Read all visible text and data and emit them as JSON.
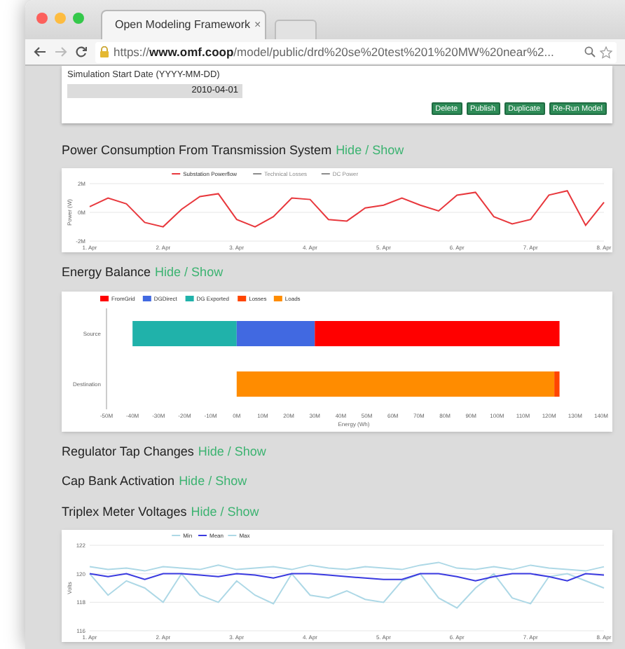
{
  "tab": {
    "title": "Open Modeling Framework",
    "close": "×"
  },
  "url": "https://**www.omf.coop**/model/public/drd%20se%20test%201%20MW%20near%2...",
  "form": {
    "label": "Simulation Start Date (YYYY-MM-DD)",
    "value": "2010-04-01",
    "buttons": [
      "Delete",
      "Publish",
      "Duplicate",
      "Re-Run Model"
    ]
  },
  "sections": [
    {
      "title": "Power Consumption From Transmission System",
      "toggle": "Hide / Show",
      "chart_data": {
        "type": "line",
        "ylabel": "Power (W)",
        "legend": true,
        "categories": [
          "1. Apr",
          null,
          null,
          null,
          "2. Apr",
          null,
          null,
          null,
          "3. Apr",
          null,
          null,
          null,
          "4. Apr",
          null,
          null,
          null,
          "5. Apr",
          null,
          null,
          null,
          "6. Apr",
          null,
          null,
          null,
          "7. Apr",
          null,
          null,
          null,
          "8. Apr"
        ],
        "ylim": [
          -2,
          2
        ],
        "yticks": [
          {
            "value": -2,
            "label": "-2M"
          },
          {
            "value": 0,
            "label": "0M"
          },
          {
            "value": 2,
            "label": "2M"
          }
        ],
        "series": [
          {
            "name": "Substation Powerflow",
            "color": "#e8383d",
            "values": [
              0.4,
              1.0,
              0.6,
              -0.7,
              -1.0,
              0.2,
              1.1,
              1.3,
              -0.5,
              -1.0,
              -0.3,
              1.0,
              0.9,
              -0.5,
              -0.6,
              0.3,
              0.5,
              1.0,
              0.5,
              0.1,
              1.2,
              1.4,
              -0.3,
              -0.8,
              -0.5,
              1.2,
              1.5,
              -0.9,
              0.7
            ]
          },
          {
            "name": "Technical Losses",
            "color": "#8c8c8c",
            "values": [
              null,
              null,
              null,
              null,
              null,
              null,
              null,
              null,
              null,
              null,
              null,
              null,
              null,
              null,
              null,
              null,
              null,
              null,
              null,
              null,
              null,
              null,
              null,
              null,
              null,
              null,
              null,
              null,
              null
            ]
          },
          {
            "name": "DC Power",
            "color": "#8c8c8c",
            "values": [
              null,
              null,
              null,
              null,
              null,
              null,
              null,
              null,
              null,
              null,
              null,
              null,
              null,
              null,
              null,
              null,
              null,
              null,
              null,
              null,
              null,
              null,
              null,
              null,
              null,
              null,
              null,
              null,
              null
            ]
          }
        ]
      }
    },
    {
      "title": "Energy Balance",
      "toggle": "Hide / Show",
      "chart_data": {
        "type": "bar",
        "orientation": "horizontal",
        "stacked": true,
        "xlabel": "Energy (Wh)",
        "legend": true,
        "categories": [
          "Source",
          "Destination"
        ],
        "xlim": [
          -50,
          140
        ],
        "xticks": [
          {
            "value": -50,
            "label": "-50M"
          },
          {
            "value": -40,
            "label": "-40M"
          },
          {
            "value": -30,
            "label": "-30M"
          },
          {
            "value": -20,
            "label": "-20M"
          },
          {
            "value": -10,
            "label": "-10M"
          },
          {
            "value": 0,
            "label": "0M"
          },
          {
            "value": 10,
            "label": "10M"
          },
          {
            "value": 20,
            "label": "20M"
          },
          {
            "value": 30,
            "label": "30M"
          },
          {
            "value": 40,
            "label": "40M"
          },
          {
            "value": 50,
            "label": "50M"
          },
          {
            "value": 60,
            "label": "60M"
          },
          {
            "value": 70,
            "label": "70M"
          },
          {
            "value": 80,
            "label": "80M"
          },
          {
            "value": 90,
            "label": "90M"
          },
          {
            "value": 100,
            "label": "100M"
          },
          {
            "value": 110,
            "label": "110M"
          },
          {
            "value": 120,
            "label": "120M"
          },
          {
            "value": 130,
            "label": "130M"
          },
          {
            "value": 140,
            "label": "140M"
          }
        ],
        "series": [
          {
            "name": "FromGrid",
            "color": "#ff0000",
            "values": [
              94,
              null
            ]
          },
          {
            "name": "DGDirect",
            "color": "#4169e1",
            "values": [
              30,
              null
            ]
          },
          {
            "name": "DG Exported",
            "color": "#20b2aa",
            "values": [
              -40,
              null
            ]
          },
          {
            "name": "Losses",
            "color": "#ff4500",
            "values": [
              null,
              2
            ]
          },
          {
            "name": "Loads",
            "color": "#ff8c00",
            "values": [
              null,
              122
            ]
          }
        ]
      }
    },
    {
      "title": "Regulator Tap Changes",
      "toggle": "Hide / Show"
    },
    {
      "title": "Cap Bank Activation",
      "toggle": "Hide / Show"
    },
    {
      "title": "Triplex Meter Voltages",
      "toggle": "Hide / Show",
      "chart_data": {
        "type": "line",
        "ylabel": "Volts",
        "legend": true,
        "categories": [
          "1. Apr",
          null,
          null,
          null,
          "2. Apr",
          null,
          null,
          null,
          "3. Apr",
          null,
          null,
          null,
          "4. Apr",
          null,
          null,
          null,
          "5. Apr",
          null,
          null,
          null,
          "6. Apr",
          null,
          null,
          null,
          "7. Apr",
          null,
          null,
          null,
          "8. Apr"
        ],
        "ylim": [
          116,
          122
        ],
        "yticks": [
          116,
          118,
          120,
          122
        ],
        "series": [
          {
            "name": "Min",
            "color": "#add8e6",
            "values": [
              120,
              118.5,
              119.5,
              119,
              118,
              120,
              118.5,
              118,
              119.5,
              118.5,
              117.9,
              120,
              118.5,
              118.3,
              118.8,
              118.2,
              118,
              119.5,
              120,
              118.3,
              117.6,
              119,
              120,
              118.3,
              117.9,
              119.8,
              120,
              119.5,
              119
            ]
          },
          {
            "name": "Mean",
            "color": "#3a3ae0",
            "values": [
              120,
              119.8,
              120,
              119.6,
              120,
              120,
              119.9,
              119.8,
              120,
              119.9,
              119.7,
              120,
              120,
              119.9,
              119.8,
              119.7,
              119.6,
              119.6,
              120,
              120,
              119.8,
              119.5,
              119.8,
              120,
              120,
              119.8,
              119.5,
              120,
              119.9
            ]
          },
          {
            "name": "Max",
            "color": "#add8e6",
            "values": [
              120.5,
              120.3,
              120.4,
              120.2,
              120.5,
              120.4,
              120.3,
              120.6,
              120.3,
              120.4,
              120.5,
              120.3,
              120.6,
              120.4,
              120.3,
              120.5,
              120.4,
              120.3,
              120.6,
              120.8,
              120.4,
              120.3,
              120.5,
              120.3,
              120.6,
              120.4,
              120.3,
              120.2,
              120.5
            ]
          }
        ]
      }
    }
  ]
}
